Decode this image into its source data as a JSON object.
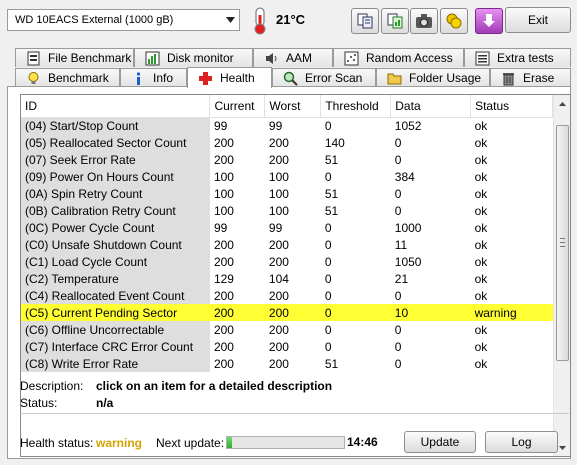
{
  "toolbar": {
    "drive_selected": "WD     10EACS External (1000 gB)",
    "temperature": "21°C",
    "exit_label": "Exit"
  },
  "tabs_top": [
    {
      "label": "File Benchmark"
    },
    {
      "label": "Disk monitor"
    },
    {
      "label": "AAM"
    },
    {
      "label": "Random Access"
    },
    {
      "label": "Extra tests"
    }
  ],
  "tabs_bottom": [
    {
      "label": "Benchmark"
    },
    {
      "label": "Info"
    },
    {
      "label": "Health",
      "active": true
    },
    {
      "label": "Error Scan"
    },
    {
      "label": "Folder Usage"
    },
    {
      "label": "Erase"
    }
  ],
  "table": {
    "columns": [
      "ID",
      "Current",
      "Worst",
      "Threshold",
      "Data",
      "Status"
    ],
    "rows": [
      [
        "(04) Start/Stop Count",
        "99",
        "99",
        "0",
        "1052",
        "ok"
      ],
      [
        "(05) Reallocated Sector Count",
        "200",
        "200",
        "140",
        "0",
        "ok"
      ],
      [
        "(07) Seek Error Rate",
        "200",
        "200",
        "51",
        "0",
        "ok"
      ],
      [
        "(09) Power On Hours Count",
        "100",
        "100",
        "0",
        "384",
        "ok"
      ],
      [
        "(0A) Spin Retry Count",
        "100",
        "100",
        "51",
        "0",
        "ok"
      ],
      [
        "(0B) Calibration Retry Count",
        "100",
        "100",
        "51",
        "0",
        "ok"
      ],
      [
        "(0C) Power Cycle Count",
        "99",
        "99",
        "0",
        "1000",
        "ok"
      ],
      [
        "(C0) Unsafe Shutdown Count",
        "200",
        "200",
        "0",
        "11",
        "ok"
      ],
      [
        "(C1) Load Cycle Count",
        "200",
        "200",
        "0",
        "1050",
        "ok"
      ],
      [
        "(C2) Temperature",
        "129",
        "104",
        "0",
        "21",
        "ok"
      ],
      [
        "(C4) Reallocated Event Count",
        "200",
        "200",
        "0",
        "0",
        "ok"
      ],
      [
        "(C5) Current Pending Sector",
        "200",
        "200",
        "0",
        "10",
        "warning"
      ],
      [
        "(C6) Offline Uncorrectable",
        "200",
        "200",
        "0",
        "0",
        "ok"
      ],
      [
        "(C7) Interface CRC Error Count",
        "200",
        "200",
        "0",
        "0",
        "ok"
      ],
      [
        "(C8) Write Error Rate",
        "200",
        "200",
        "51",
        "0",
        "ok"
      ]
    ],
    "highlighted_row": 11
  },
  "info": {
    "description_label": "Description:",
    "description_value": "click on an item for a detailed description",
    "status_label": "Status:",
    "status_value": "n/a"
  },
  "footer": {
    "health_label": "Health status:",
    "health_value": "warning",
    "next_update_label": "Next update:",
    "next_update_time": "14:46",
    "progress_fraction": 0.04,
    "update_label": "Update",
    "log_label": "Log"
  },
  "colors": {
    "highlight_row": "#ffff33",
    "warning_text": "#d4a400",
    "id_column_bg": "#dedede"
  },
  "icons": [
    "thermometer-icon",
    "copy-icon",
    "copy-green-icon",
    "camera-icon",
    "coins-icon",
    "download-icon"
  ]
}
